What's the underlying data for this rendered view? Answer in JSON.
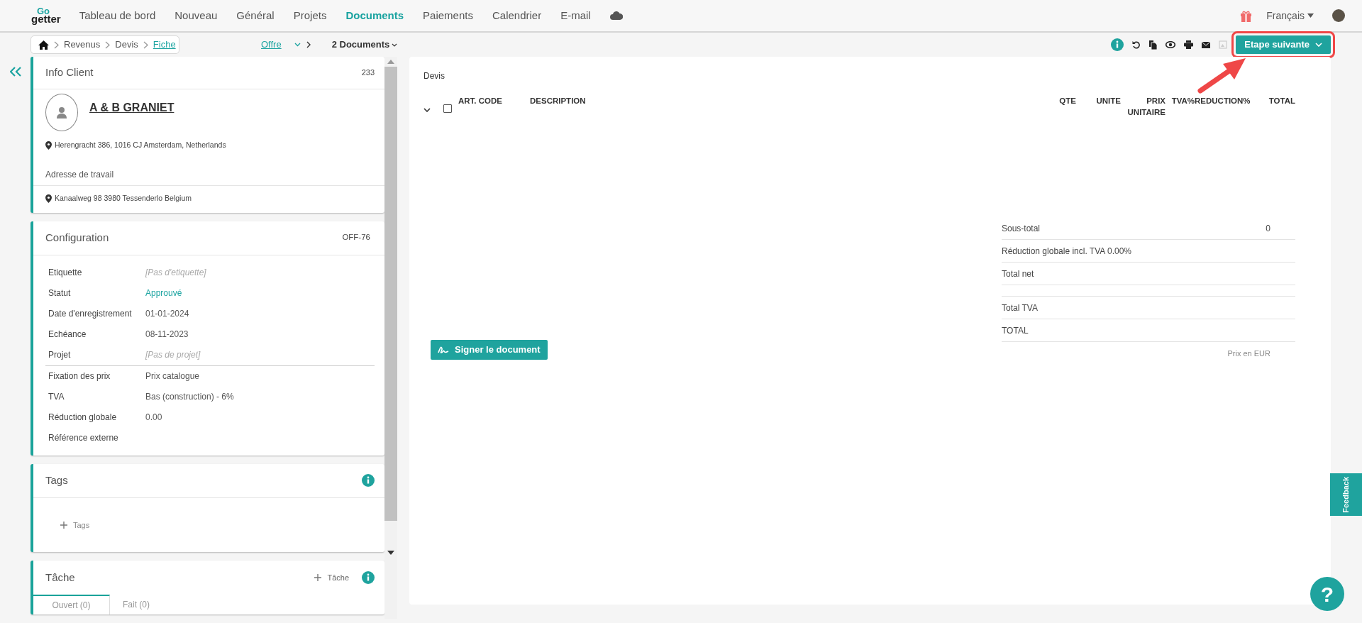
{
  "logo": {
    "line_1": "Go",
    "line_2": "getter"
  },
  "nav": {
    "items": [
      {
        "label": "Tableau de bord",
        "selected": false
      },
      {
        "label": "Nouveau",
        "selected": false
      },
      {
        "label": "Général",
        "selected": false
      },
      {
        "label": "Projets",
        "selected": false
      },
      {
        "label": "Documents",
        "selected": true
      },
      {
        "label": "Paiements",
        "selected": false
      },
      {
        "label": "Calendrier",
        "selected": false
      },
      {
        "label": "E-mail",
        "selected": false
      }
    ],
    "language": "Français"
  },
  "breadcrumb": [
    {
      "label": "Revenus",
      "current": false
    },
    {
      "label": "Devis",
      "current": false
    },
    {
      "label": "Fiche",
      "current": true
    }
  ],
  "document_nav": {
    "stage": "Offre",
    "documents": "2 Documents"
  },
  "toolbar": {
    "next_step": "Etape suivante"
  },
  "info_client": {
    "title": "Info Client",
    "number": "233",
    "name": "A & B GRANIET",
    "address": "Herengracht 386, 1016 CJ Amsterdam, Netherlands",
    "work_address_label": "Adresse de travail",
    "work_address": "Kanaalweg 98 3980 Tessenderlo Belgium"
  },
  "configuration": {
    "title": "Configuration",
    "code": "OFF-76",
    "field_groups": [
      [
        {
          "label": "Etiquette",
          "value": "[Pas d'etiquette]",
          "kind": "empty"
        },
        {
          "label": "Statut",
          "value": "Approuvé",
          "kind": "status"
        },
        {
          "label": "Date d'enregistrement",
          "value": "01-01-2024",
          "kind": "text"
        },
        {
          "label": "Echéance",
          "value": "08-11-2023",
          "kind": "text"
        },
        {
          "label": "Projet",
          "value": "[Pas de projet]",
          "kind": "empty"
        }
      ],
      [
        {
          "label": "Fixation des prix",
          "value": "Prix catalogue",
          "kind": "text"
        },
        {
          "label": "TVA",
          "value": "Bas (construction) - 6%",
          "kind": "text"
        },
        {
          "label": "Réduction globale",
          "value": "0.00",
          "kind": "text"
        },
        {
          "label": "Référence externe"
        }
      ]
    ]
  },
  "tags": {
    "title": "Tags",
    "add": "Tags"
  },
  "task": {
    "title": "Tâche",
    "add": "Tâche",
    "tabs": [
      {
        "label": "Ouvert (0)",
        "selected": true
      },
      {
        "label": "Fait (0)",
        "selected": false
      }
    ]
  },
  "document": {
    "title": "Devis",
    "table": {
      "select_all": {
        "checked": false
      },
      "columns": [
        "ART. CODE",
        "DESCRIPTION",
        "QTE",
        "UNITE",
        "PRIX UNITAIRE",
        "TVA%",
        "REDUCTION%",
        "TOTAL"
      ]
    },
    "sign_button": "Signer le document",
    "totals": [
      {
        "kind": "line",
        "label": "Sous-total",
        "value": "0"
      },
      {
        "kind": "line",
        "label": "Réduction globale incl. TVA 0.00%"
      },
      {
        "kind": "line",
        "label": "Total net"
      },
      {
        "kind": "blank"
      },
      {
        "kind": "line",
        "label": "Total TVA"
      },
      {
        "kind": "line",
        "label": "TOTAL"
      }
    ],
    "currency_note": "Prix en EUR"
  },
  "feedback": "Feedback",
  "help": "?"
}
